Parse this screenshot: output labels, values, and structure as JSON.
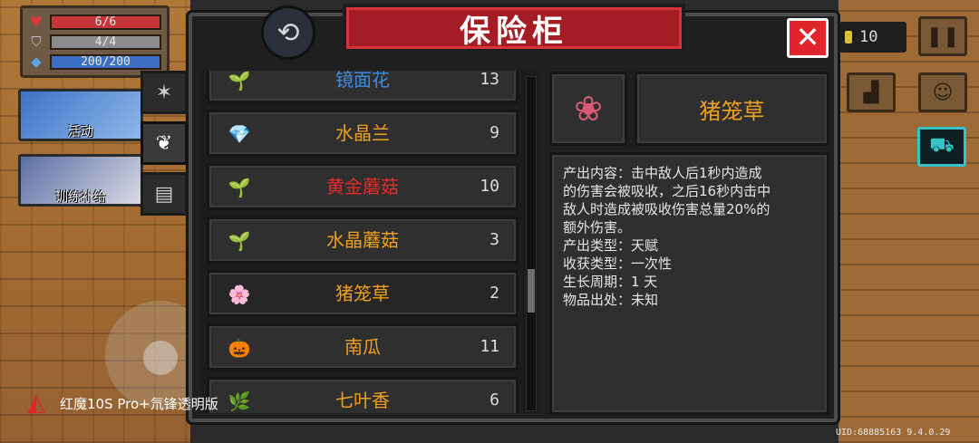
{
  "hud": {
    "hp": "6/6",
    "hp_level": 1.0,
    "armor": "4/4",
    "armor_level": 1.0,
    "energy": "200/200",
    "energy_level": 1.0
  },
  "side_cards": {
    "activity": "活动",
    "training": "训练补给"
  },
  "panel": {
    "title": "保险柜",
    "close_label": "✕",
    "replay_icon": "⟲"
  },
  "tabs": [
    {
      "icon": "✶",
      "name": "materials"
    },
    {
      "icon": "❦",
      "name": "plants"
    },
    {
      "icon": "▤",
      "name": "misc"
    }
  ],
  "list": [
    {
      "name": "镜面花",
      "count": "13",
      "color": "#3d8de0",
      "icon": "🌱"
    },
    {
      "name": "水晶兰",
      "count": "9",
      "color": "#f0a020",
      "icon": "💎"
    },
    {
      "name": "黄金蘑菇",
      "count": "10",
      "color": "#e22b2b",
      "icon": "🌱"
    },
    {
      "name": "水晶蘑菇",
      "count": "3",
      "color": "#f0a020",
      "icon": "🌱"
    },
    {
      "name": "猪笼草",
      "count": "2",
      "color": "#f0a020",
      "icon": "🌸"
    },
    {
      "name": "南瓜",
      "count": "11",
      "color": "#f0a020",
      "icon": "🎃"
    },
    {
      "name": "七叶香",
      "count": "6",
      "color": "#f0a020",
      "icon": "🌿"
    }
  ],
  "detail": {
    "name": "猪笼草",
    "lines": [
      "产出内容：击中敌人后1秒内造成",
      "的伤害会被吸收，之后16秒内击中",
      "敌人时造成被吸收伤害总量20%的",
      "额外伤害。",
      "产出类型：天赋",
      "收获类型：一次性",
      "生长周期：1 天",
      "物品出处：未知"
    ]
  },
  "right_hud": {
    "coins": "10"
  },
  "footer": {
    "uid": "UID:68885163 9.4.0.29",
    "device": "红魔10S Pro+氘锋透明版"
  },
  "colors": {
    "banner": "#a51d24",
    "close": "#e0252d",
    "rare_orange": "#f0a020",
    "rare_red": "#e22b2b",
    "rare_blue": "#3d8de0",
    "shop": "#35c3c8"
  }
}
